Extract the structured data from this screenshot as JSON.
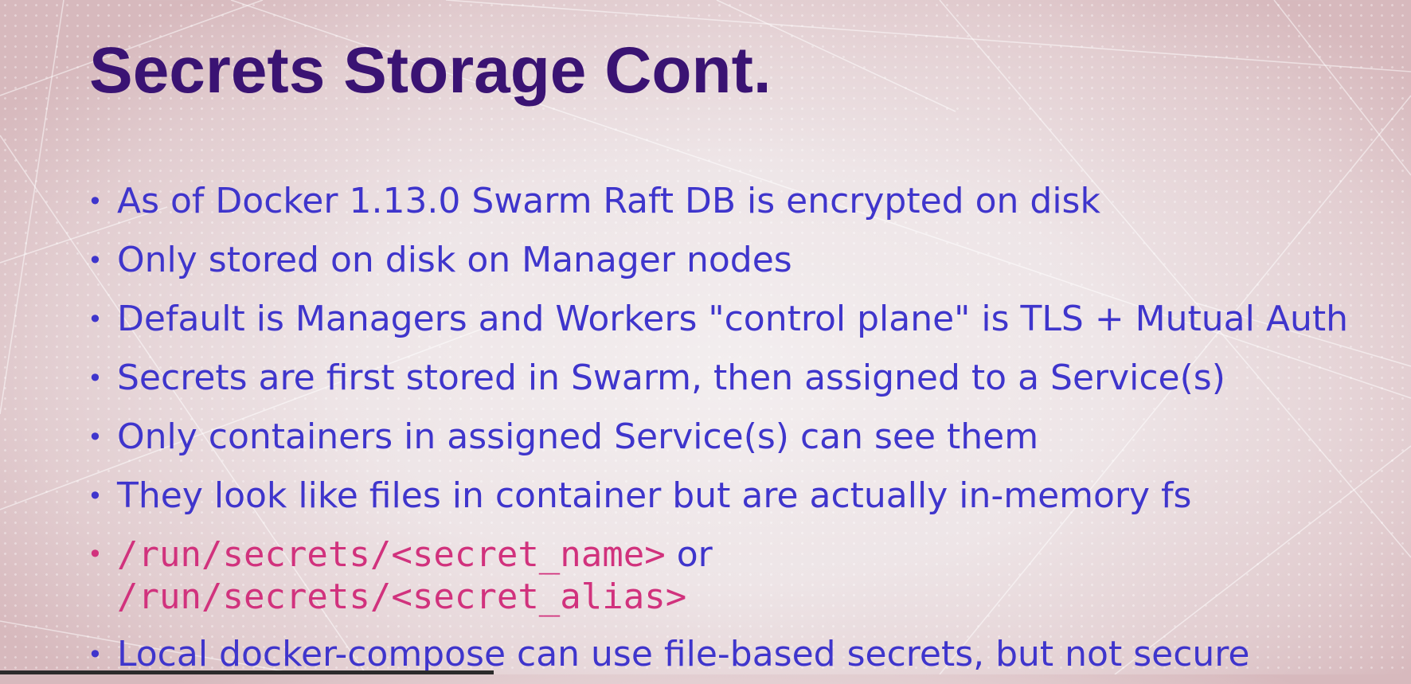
{
  "slide": {
    "title": "Secrets Storage Cont.",
    "bullets": [
      "As of Docker 1.13.0 Swarm Raft DB is encrypted on disk",
      "Only stored on disk on Manager nodes",
      "Default is Managers and Workers \"control plane\" is TLS + Mutual Auth",
      "Secrets are first stored in Swarm, then assigned to a Service(s)",
      "Only containers in assigned Service(s) can see them",
      "They look like files in container but are actually in-memory fs"
    ],
    "code_bullet": {
      "path_name": "/run/secrets/<secret_name>",
      "connector": "or",
      "path_alias": "/run/secrets/<secret_alias>"
    },
    "last_bullet": "Local docker-compose can use file-based secrets, but not secure",
    "bullet_symbol": "•"
  },
  "colors": {
    "title": "#3a1373",
    "text": "#3f35cc",
    "code": "#d1327d"
  }
}
